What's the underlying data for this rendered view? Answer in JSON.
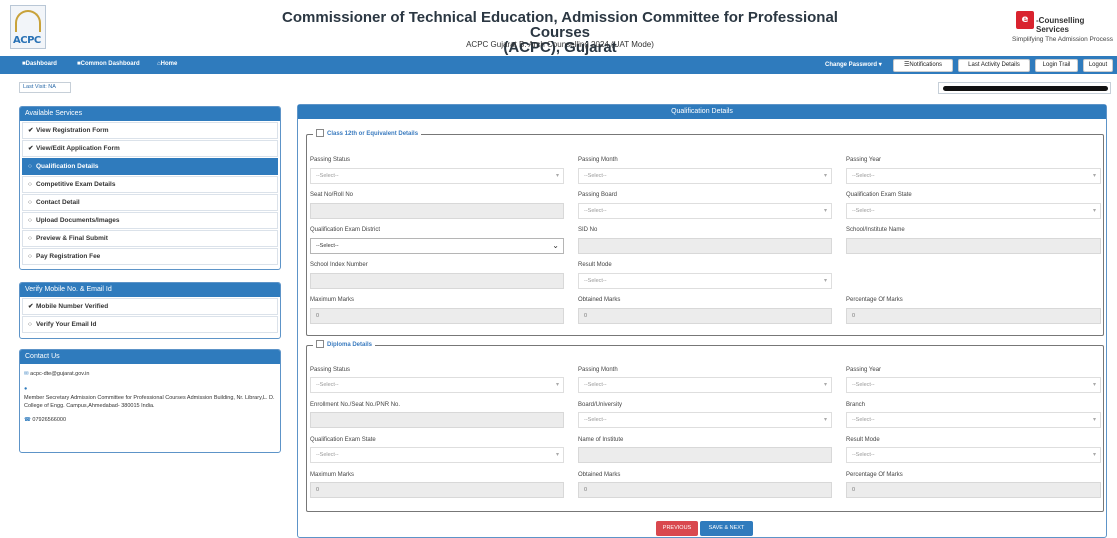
{
  "header": {
    "logo_text": "ACPC",
    "title_line1": "Commissioner of Technical Education, Admission Committee for Professional Courses",
    "title_line2": "(ACPC), Gujarat",
    "subtitle": "ACPC Gujarat B. Arch Counselling 2024 (UAT Mode)",
    "brand_mark": "e",
    "brand_title": "-Counselling Services",
    "brand_tagline": "Simplifying The Admission Process"
  },
  "nav": {
    "dashboard": "Dashboard",
    "common_dashboard": "Common Dashboard",
    "home": "Home",
    "change_password": "Change Password",
    "notifications": "Notifications",
    "last_activity": "Last Activity Details",
    "login_trail": "Login Trail",
    "logout": "Logout"
  },
  "last_visit": "Last Visit: NA",
  "services": {
    "title": "Available Services",
    "items": [
      {
        "label": "View Registration Form",
        "icon": "check-circle-icon",
        "active": false
      },
      {
        "label": "View/Edit Application Form",
        "icon": "check-circle-icon",
        "active": false
      },
      {
        "label": "Qualification Details",
        "icon": "circle-icon",
        "active": true
      },
      {
        "label": "Competitive Exam Details",
        "icon": "circle-icon",
        "active": false
      },
      {
        "label": "Contact Detail",
        "icon": "circle-icon",
        "active": false
      },
      {
        "label": "Upload Documents/Images",
        "icon": "circle-icon",
        "active": false
      },
      {
        "label": "Preview & Final Submit",
        "icon": "circle-icon",
        "active": false
      },
      {
        "label": "Pay Registration Fee",
        "icon": "circle-icon",
        "active": false
      }
    ]
  },
  "verify": {
    "title": "Verify Mobile No. & Email Id",
    "mobile": "Mobile Number Verified",
    "email": "Verify Your Email Id"
  },
  "contact": {
    "title": "Contact Us",
    "email": "acpc-dte@gujarat.gov.in",
    "address": "Member Secretary Admission Committee for Professional Courses Admission Building, Nr. Library,L. D. College of Engg. Campus,Ahmedabad- 380015 India.",
    "phone": "07926566000"
  },
  "qualification": {
    "title": "Qualification Details",
    "class12": {
      "legend": "Class 12th or Equivalent Details",
      "passing_status": "Passing Status",
      "passing_month": "Passing Month",
      "passing_year": "Passing Year",
      "seat_no": "Seat No/Roll No",
      "passing_board": "Passing Board",
      "exam_state": "Qualification Exam State",
      "exam_district": "Qualification Exam District",
      "sid_no": "SID No",
      "school_name": "School/Institute Name",
      "school_index": "School Index Number",
      "result_mode": "Result Mode",
      "max_marks": "Maximum Marks",
      "obtained_marks": "Obtained Marks",
      "percentage": "Percentage Of Marks"
    },
    "diploma": {
      "legend": "Diploma Details",
      "passing_status": "Passing Status",
      "passing_month": "Passing Month",
      "passing_year": "Passing Year",
      "enrollment": "Enrollment No./Seat No./PNR No.",
      "board": "Board/University",
      "branch": "Branch",
      "exam_state": "Qualification Exam State",
      "institute": "Name of Institute",
      "result_mode": "Result Mode",
      "max_marks": "Maximum Marks",
      "obtained_marks": "Obtained Marks",
      "percentage": "Percentage Of Marks"
    },
    "select_placeholder": "--Select--",
    "district_placeholder": "--Select--",
    "zero": "0",
    "previous": "PREVIOUS",
    "save_next": "SAVE & NEXT"
  }
}
